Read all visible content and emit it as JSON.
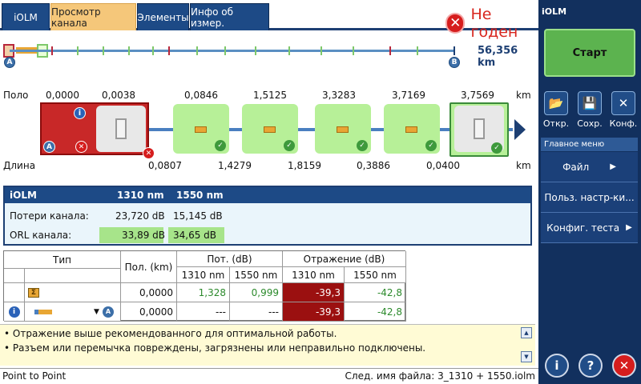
{
  "tabs": [
    "iOLM",
    "Просмотр канала",
    "Элементы",
    "Инфо об измер."
  ],
  "status": {
    "text": "Не годен"
  },
  "overview": {
    "distance": "56,356 km",
    "marker_a": "A",
    "marker_b": "B"
  },
  "link_view": {
    "position_label": "Поло",
    "length_label": "Длина",
    "unit": "km",
    "positions": [
      "0,0000",
      "0,0038",
      "0,0846",
      "1,5125",
      "3,3283",
      "3,7169",
      "3,7569"
    ],
    "lengths": [
      "0,0807",
      "1,4279",
      "1,8159",
      "0,3886",
      "0,0400"
    ]
  },
  "summary": {
    "header": {
      "name": "iOLM",
      "col1": "1310 nm",
      "col2": "1550 nm"
    },
    "rows": [
      {
        "label": "Потери канала:",
        "v1": "23,720 dB",
        "v2": "15,145 dB"
      },
      {
        "label": "ORL канала:",
        "v1": "33,89 dB",
        "v2": "34,65 dB"
      }
    ]
  },
  "table": {
    "headers": {
      "type": "Тип",
      "pos": "Пол. (km)",
      "loss": "Пот. (dB)",
      "refl": "Отражение (dB)",
      "nm1310": "1310 nm",
      "nm1550": "1550 nm"
    },
    "rows": [
      {
        "pos": "0,0000",
        "loss1310": "1,328",
        "loss1550": "0,999",
        "refl1310": "-39,3",
        "refl1550": "-42,8"
      },
      {
        "pos": "0,0000",
        "loss1310": "---",
        "loss1550": "---",
        "refl1310": "-39,3",
        "refl1550": "-42,8"
      }
    ]
  },
  "messages": [
    "• Отражение выше рекомендованного для оптимальной работы.",
    "• Разъем или перемычка повреждены, загрязнены или неправильно подключены."
  ],
  "statusbar": {
    "left": "Point to Point",
    "right": "След. имя файла: 3_1310 + 1550.iolm"
  },
  "right_panel": {
    "title": "iOLM",
    "start": "Старт",
    "tools": [
      "Откр.",
      "Сохр.",
      "Конф."
    ],
    "menu_title": "Главное меню",
    "menu": [
      "Файл",
      "Польз. настр-ки...",
      "Конфиг. теста"
    ]
  }
}
